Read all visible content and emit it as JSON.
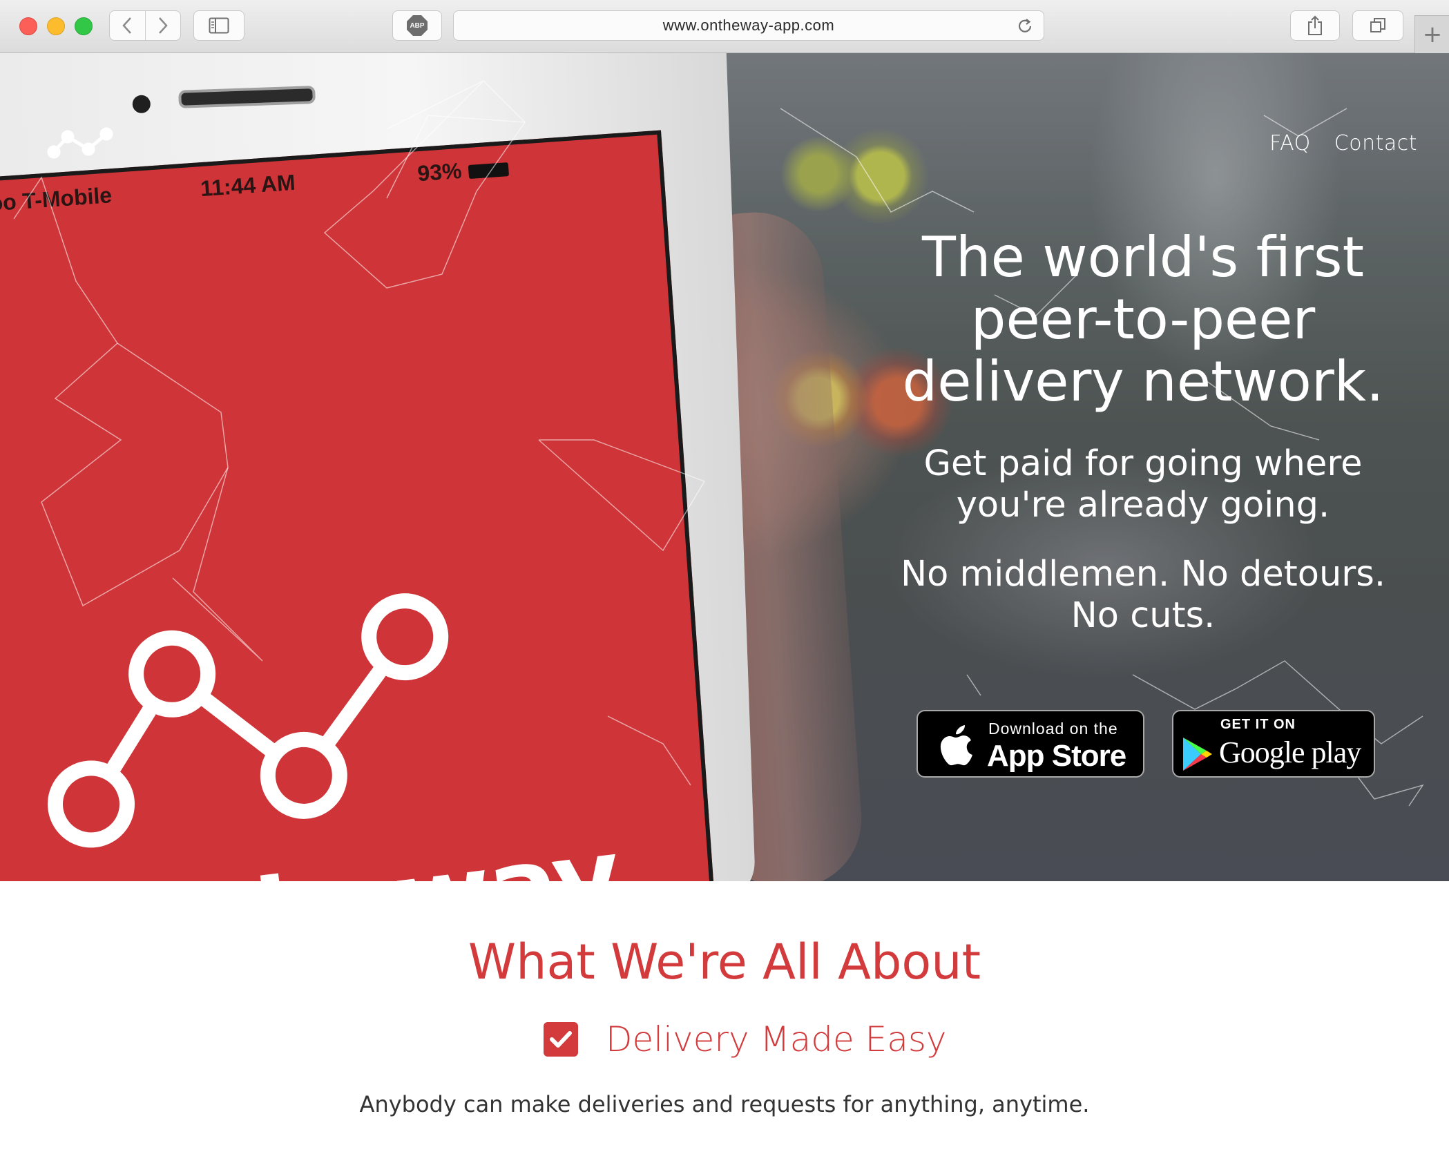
{
  "browser": {
    "url": "www.ontheway-app.com",
    "adblock_label": "ABP",
    "new_tab_symbol": "+"
  },
  "nav": {
    "faq": "FAQ",
    "contact": "Contact"
  },
  "phone": {
    "carrier": "ooooo T-Mobile",
    "time": "11:44 AM",
    "battery": "93%",
    "brand": "ontheway"
  },
  "hero": {
    "headline_1": "The world's first",
    "headline_2": "peer-to-peer",
    "headline_3": "delivery network.",
    "sub1_line1": "Get paid for going where",
    "sub1_line2": "you're already going.",
    "sub2_line1": "No middlemen. No detours.",
    "sub2_line2": "No cuts."
  },
  "appstore": {
    "small": "Download on the",
    "big": "App Store"
  },
  "googleplay": {
    "small": "GET IT ON",
    "big": "Google play"
  },
  "about": {
    "title": "What We're All About",
    "feature_title": "Delivery Made Easy",
    "feature_desc": "Anybody can make deliveries and requests for anything, anytime."
  },
  "colors": {
    "brand_red": "#d23a3c",
    "phone_screen_red": "#cf3538"
  }
}
